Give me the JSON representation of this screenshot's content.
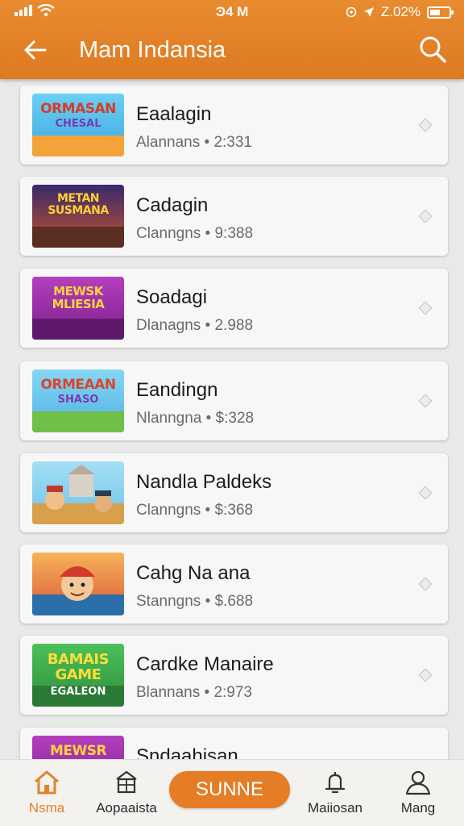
{
  "status": {
    "time": "Ͽ4 M",
    "battery": "Z.02%"
  },
  "appbar": {
    "title": "Mam Indansia"
  },
  "items": [
    {
      "title": "Eaalagin",
      "subtitle": "Alannans • 2:331",
      "art": "ORMASAN",
      "art2": "CHESAL",
      "sky": "#5fc3ef",
      "ground": "#f2a33a",
      "ink": "#d93a2a"
    },
    {
      "title": "Cadagin",
      "subtitle": "Clanngns • 9:388",
      "art": "METAN SUSMANA",
      "art2": "",
      "sky": "#5a2d7a",
      "ground": "#6b3a2a",
      "ink": "#ffcf3a"
    },
    {
      "title": "Soadagi",
      "subtitle": "Dlanagns • 2.988",
      "art": "MEWSK MLIESIA",
      "art2": "",
      "sky": "#a63bb5",
      "ground": "#6a1f7a",
      "ink": "#ffd23b"
    },
    {
      "title": "Eandingn",
      "subtitle": "Nlanngna • $:328",
      "art": "ORMEAAN",
      "art2": "SHASO",
      "sky": "#7fcdf2",
      "ground": "#6fbf48",
      "ink": "#d9452b"
    },
    {
      "title": "Nandla Paldeks",
      "subtitle": "Clanngns • $:368",
      "art": "",
      "art2": "",
      "sky": "#8fd3f0",
      "ground": "#d8a04a",
      "ink": "#c0392b"
    },
    {
      "title": "Cahg  Na ana",
      "subtitle": "Stanngns • $.688",
      "art": "",
      "art2": "",
      "sky": "#f39a4a",
      "ground": "#2a6fa8",
      "ink": "#d23a2a"
    },
    {
      "title": "Cardke Manaire",
      "subtitle": "Blannans • 2:973",
      "art": "BAMAIS GAME",
      "art2": "EGALEON",
      "sky": "#3aa84a",
      "ground": "#2f7f3a",
      "ink": "#ffde3a"
    },
    {
      "title": "Sndaahisan",
      "subtitle": "",
      "art": "MEWSR",
      "art2": "",
      "sky": "#a63bb5",
      "ground": "#6a1f7a",
      "ink": "#ffd23b"
    }
  ],
  "nav": {
    "home": "Nsma",
    "apps": "Aopaaista",
    "center": "SUNNE",
    "mail": "Maiiosan",
    "profile": "Mang"
  },
  "colors": {
    "accent": "#e47d25",
    "background": "#e9e9e9",
    "card": "#f7f7f7"
  }
}
